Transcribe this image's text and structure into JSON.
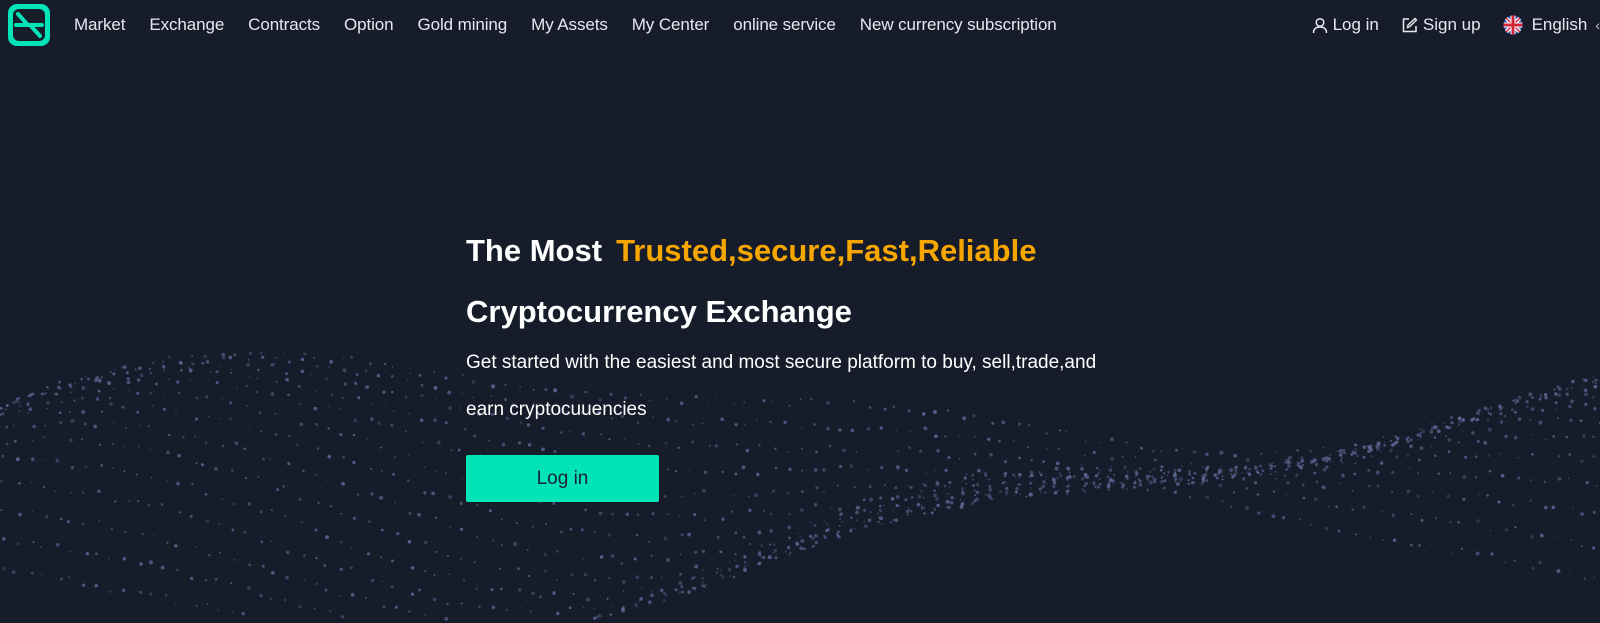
{
  "nav": {
    "items": [
      {
        "label": "Market"
      },
      {
        "label": "Exchange"
      },
      {
        "label": "Contracts"
      },
      {
        "label": "Option"
      },
      {
        "label": "Gold mining"
      },
      {
        "label": "My Assets"
      },
      {
        "label": "My Center"
      },
      {
        "label": "online service"
      },
      {
        "label": "New currency subscription"
      }
    ],
    "login_label": "Log in",
    "signup_label": "Sign up",
    "language_label": "English"
  },
  "hero": {
    "title_prefix": "The Most",
    "title_accent": "Trusted,secure,Fast,Reliable",
    "title_line2": "Cryptocurrency Exchange",
    "subtitle": "Get started with the easiest and most secure platform to buy, sell,trade,and earn cryptocuuencies",
    "cta_label": "Log in"
  },
  "colors": {
    "background": "#171c2b",
    "accent_orange": "#f7a600",
    "brand_teal": "#00e4b8",
    "particle": "#5c6894"
  },
  "icons": {
    "logo": "brand-logo",
    "login": "user-icon",
    "signup": "edit-icon",
    "language": "uk-flag-icon",
    "language_toggle": "chevron-left-icon"
  }
}
